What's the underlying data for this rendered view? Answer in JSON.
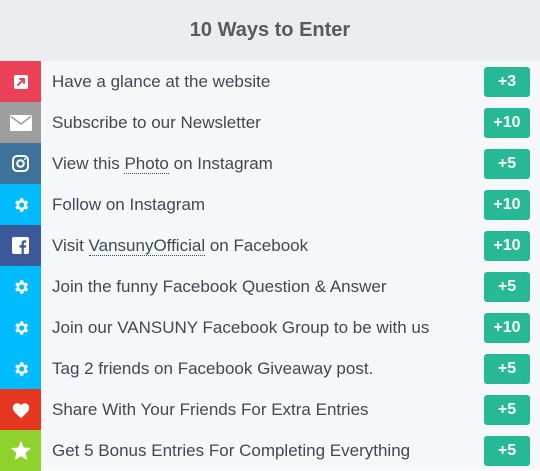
{
  "title": "10 Ways to Enter",
  "entries": [
    {
      "icon": "external-link-icon",
      "color": "#ea4157",
      "pre": "Have a glance at the website",
      "link": "",
      "post": "",
      "points": "+3"
    },
    {
      "icon": "envelope-icon",
      "color": "#9e9e9e",
      "pre": "Subscribe to our Newsletter",
      "link": "",
      "post": "",
      "points": "+10"
    },
    {
      "icon": "instagram-icon",
      "color": "#3f729b",
      "pre": "View this ",
      "link": "Photo",
      "post": " on Instagram",
      "points": "+5"
    },
    {
      "icon": "gear-icon",
      "color": "#00bcff",
      "pre": "Follow on Instagram",
      "link": "",
      "post": "",
      "points": "+10"
    },
    {
      "icon": "facebook-icon",
      "color": "#3b5998",
      "pre": "Visit ",
      "link": "VansunyOfficial",
      "post": " on Facebook",
      "points": "+10"
    },
    {
      "icon": "gear-icon",
      "color": "#00bcff",
      "pre": "Join the funny Facebook Question & Answer",
      "link": "",
      "post": "",
      "points": "+5"
    },
    {
      "icon": "gear-icon",
      "color": "#00bcff",
      "pre": "Join our VANSUNY Facebook Group to be with us",
      "link": "",
      "post": "",
      "points": "+10"
    },
    {
      "icon": "gear-icon",
      "color": "#00bcff",
      "pre": "Tag 2 friends on Facebook Giveaway post.",
      "link": "",
      "post": "",
      "points": "+5"
    },
    {
      "icon": "heart-icon",
      "color": "#e5371f",
      "pre": "Share With Your Friends For Extra Entries",
      "link": "",
      "post": "",
      "points": "+5"
    },
    {
      "icon": "star-icon",
      "color": "#8ed22b",
      "pre": "Get 5 Bonus Entries For Completing Everything",
      "link": "",
      "post": "",
      "points": "+5"
    }
  ],
  "colors": {
    "points_badge": "#27b995",
    "text": "#3d4a55",
    "header_bg": "#ecedee",
    "list_bg": "#f6f7f8"
  }
}
